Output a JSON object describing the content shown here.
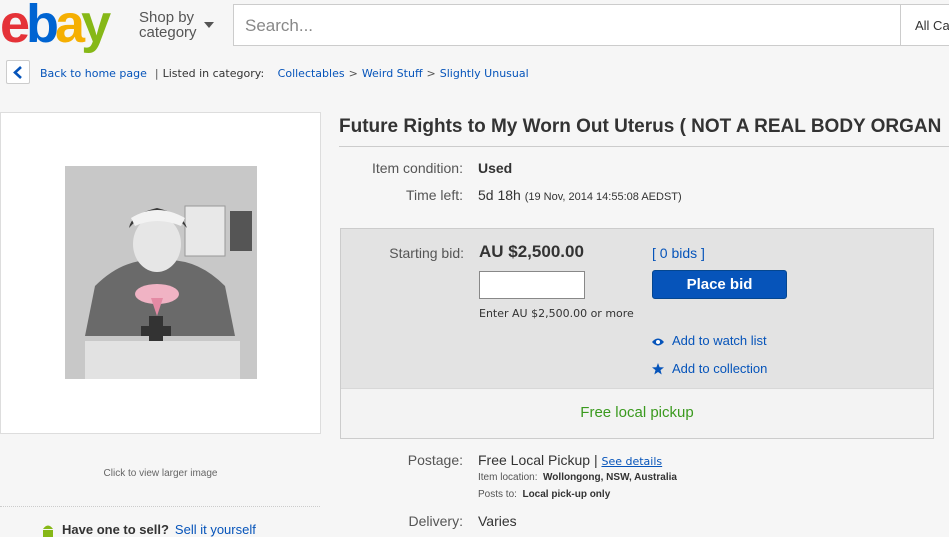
{
  "header": {
    "logo_letters": [
      "e",
      "b",
      "a",
      "y"
    ],
    "logo_colors": [
      "#e53238",
      "#0064d2",
      "#f5af02",
      "#86b817"
    ],
    "shop_by_line1": "Shop by",
    "shop_by_line2": "category",
    "search_placeholder": "Search...",
    "all_categories": "All Ca"
  },
  "breadcrumb": {
    "back_label": "Back to home page",
    "listed_label": "Listed in category:",
    "items": [
      "Collectables",
      "Weird Stuff",
      "Slightly Unusual"
    ]
  },
  "image_panel": {
    "hint": "Click to view larger image",
    "sell_question": "Have one to sell?",
    "sell_link": "Sell it yourself"
  },
  "item": {
    "title": "Future Rights to My Worn Out Uterus ( NOT A REAL BODY ORGAN",
    "condition_label": "Item condition:",
    "condition_value": "Used",
    "time_label": "Time left:",
    "time_value": "5d 18h",
    "time_detail": "(19 Nov, 2014  14:55:08 AEDST)"
  },
  "bid": {
    "starting_label": "Starting bid:",
    "price": "AU $2,500.00",
    "bids_link": "[ 0 bids ]",
    "place_bid": "Place bid",
    "enter_hint": "Enter AU $2,500.00 or more",
    "watch_list": "Add to watch list",
    "collection": "Add to collection",
    "pickup": "Free local pickup"
  },
  "shipping": {
    "postage_label": "Postage:",
    "postage_value": "Free Local Pickup",
    "see_details": "See details",
    "location_label": "Item location:",
    "location_value": "Wollongong, NSW, Australia",
    "posts_label": "Posts to:",
    "posts_value": "Local pick-up only",
    "delivery_label": "Delivery:",
    "delivery_value": "Varies"
  },
  "colors": {
    "link": "#0654ba",
    "button": "#0654ba",
    "pickup_green": "#3a9a1e"
  }
}
